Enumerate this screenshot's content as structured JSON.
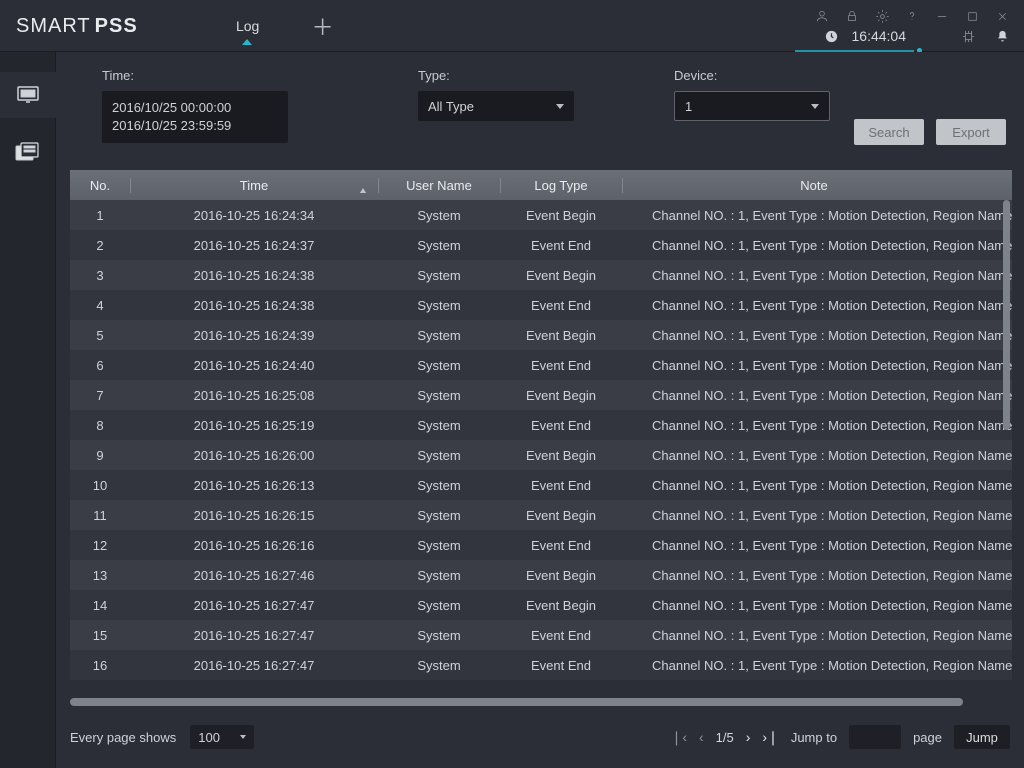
{
  "brand": {
    "left": "SMART",
    "right": "PSS"
  },
  "tabs": {
    "active": "Log"
  },
  "clock": "16:44:04",
  "filters": {
    "time_label": "Time:",
    "time_from": "2016/10/25 00:00:00",
    "time_to": "2016/10/25 23:59:59",
    "type_label": "Type:",
    "type_value": "All Type",
    "device_label": "Device:",
    "device_value": "1",
    "search": "Search",
    "export": "Export"
  },
  "columns": {
    "no": "No.",
    "time": "Time",
    "user": "User Name",
    "type": "Log Type",
    "note": "Note"
  },
  "note_common": "Channel NO. : 1, Event Type : Motion Detection, Region Name",
  "rows": [
    {
      "no": 1,
      "time": "2016-10-25 16:24:34",
      "user": "System",
      "type": "Event Begin"
    },
    {
      "no": 2,
      "time": "2016-10-25 16:24:37",
      "user": "System",
      "type": "Event End"
    },
    {
      "no": 3,
      "time": "2016-10-25 16:24:38",
      "user": "System",
      "type": "Event Begin"
    },
    {
      "no": 4,
      "time": "2016-10-25 16:24:38",
      "user": "System",
      "type": "Event End"
    },
    {
      "no": 5,
      "time": "2016-10-25 16:24:39",
      "user": "System",
      "type": "Event Begin"
    },
    {
      "no": 6,
      "time": "2016-10-25 16:24:40",
      "user": "System",
      "type": "Event End"
    },
    {
      "no": 7,
      "time": "2016-10-25 16:25:08",
      "user": "System",
      "type": "Event Begin"
    },
    {
      "no": 8,
      "time": "2016-10-25 16:25:19",
      "user": "System",
      "type": "Event End"
    },
    {
      "no": 9,
      "time": "2016-10-25 16:26:00",
      "user": "System",
      "type": "Event Begin"
    },
    {
      "no": 10,
      "time": "2016-10-25 16:26:13",
      "user": "System",
      "type": "Event End"
    },
    {
      "no": 11,
      "time": "2016-10-25 16:26:15",
      "user": "System",
      "type": "Event Begin"
    },
    {
      "no": 12,
      "time": "2016-10-25 16:26:16",
      "user": "System",
      "type": "Event End"
    },
    {
      "no": 13,
      "time": "2016-10-25 16:27:46",
      "user": "System",
      "type": "Event Begin"
    },
    {
      "no": 14,
      "time": "2016-10-25 16:27:47",
      "user": "System",
      "type": "Event Begin"
    },
    {
      "no": 15,
      "time": "2016-10-25 16:27:47",
      "user": "System",
      "type": "Event End"
    },
    {
      "no": 16,
      "time": "2016-10-25 16:27:47",
      "user": "System",
      "type": "Event End"
    }
  ],
  "footer": {
    "perpage_label": "Every page shows",
    "perpage_value": "100",
    "page_info": "1/5",
    "jump_label": "Jump to",
    "page_word": "page",
    "jump_btn": "Jump"
  }
}
